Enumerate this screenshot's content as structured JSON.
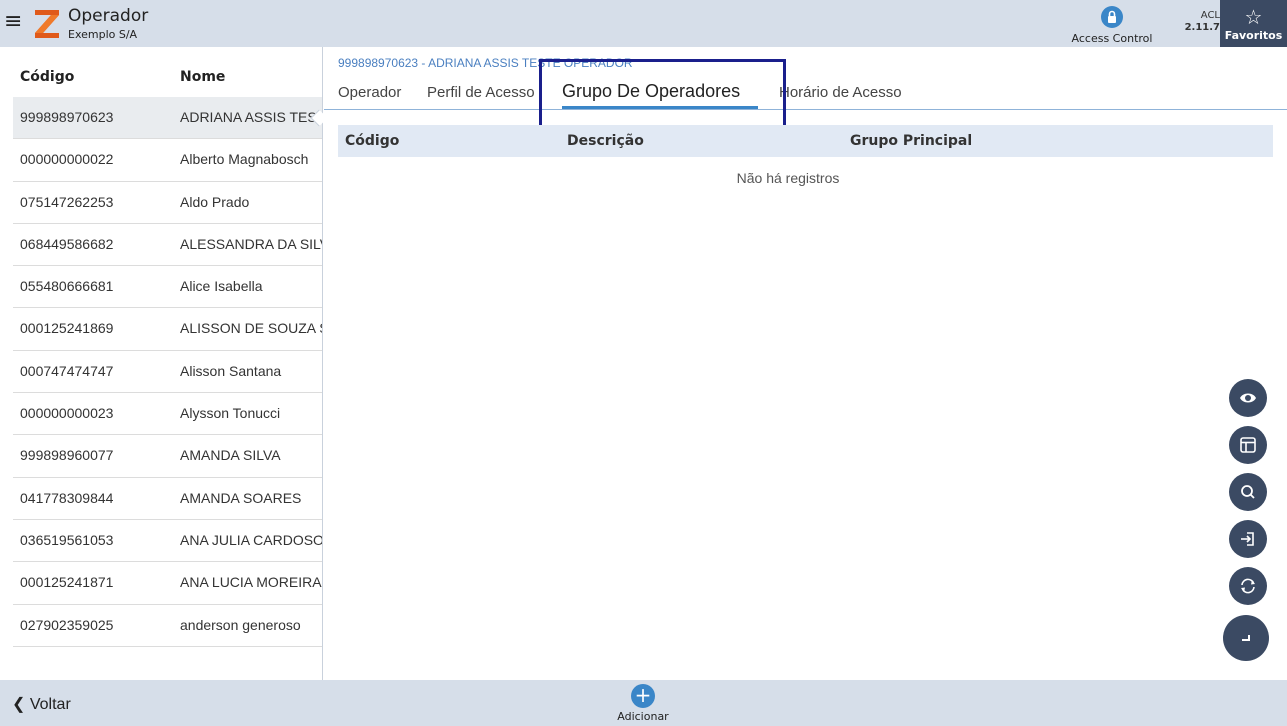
{
  "header": {
    "title": "Operador",
    "subtitle": "Exemplo S/A",
    "access_control_label": "Access Control",
    "version_app": "ACL",
    "version_number": "2.11.7",
    "favorites_label": "Favoritos"
  },
  "list": {
    "col_code": "Código",
    "col_name": "Nome",
    "rows": [
      {
        "code": "999898970623",
        "name": "ADRIANA ASSIS TESTE OPERADOR"
      },
      {
        "code": "000000000022",
        "name": "Alberto Magnabosch"
      },
      {
        "code": "075147262253",
        "name": "Aldo Prado"
      },
      {
        "code": "068449586682",
        "name": "ALESSANDRA DA SILVA"
      },
      {
        "code": "055480666681",
        "name": "Alice Isabella"
      },
      {
        "code": "000125241869",
        "name": "ALISSON DE SOUZA SANTOS"
      },
      {
        "code": "000747474747",
        "name": "Alisson Santana"
      },
      {
        "code": "000000000023",
        "name": "Alysson Tonucci"
      },
      {
        "code": "999898960077",
        "name": "AMANDA SILVA"
      },
      {
        "code": "041778309844",
        "name": "AMANDA SOARES"
      },
      {
        "code": "036519561053",
        "name": "ANA JULIA CARDOSO"
      },
      {
        "code": "000125241871",
        "name": "ANA LUCIA MOREIRA"
      },
      {
        "code": "027902359025",
        "name": "anderson generoso"
      }
    ]
  },
  "detail": {
    "record_header": "999898970623 - ADRIANA ASSIS TESTE OPERADOR",
    "tabs": [
      "Operador",
      "Perfil de Acesso",
      "Grupo De Operadores",
      "Horário de Acesso"
    ],
    "active_tab": "Grupo De Operadores",
    "grid_columns": [
      "Código",
      "Descrição",
      "Grupo Principal"
    ],
    "empty_message": "Não há registros"
  },
  "fabs": [
    "eye-icon",
    "layout-icon",
    "search-icon",
    "export-icon",
    "refresh-icon",
    "corner-icon"
  ],
  "footer": {
    "back_label": "Voltar",
    "add_label": "Adicionar"
  },
  "colors": {
    "bar_bg": "#d6dee9",
    "accent": "#3a86c8",
    "dark": "#3b4a63",
    "highlight": "#1a1f8c"
  }
}
